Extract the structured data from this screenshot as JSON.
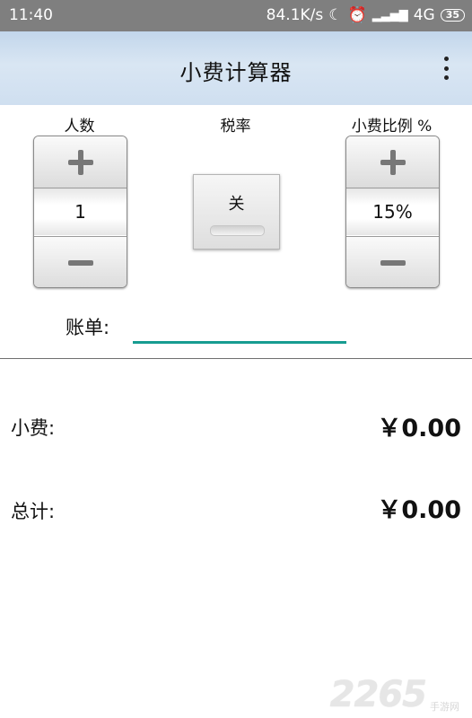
{
  "status_bar": {
    "time": "11:40",
    "speed": "84.1K/s",
    "icons": [
      "moon-icon",
      "alarm-icon",
      "signal-icon"
    ],
    "network": "4G",
    "battery": "35"
  },
  "app_bar": {
    "title": "小费计算器",
    "menu_icon": "overflow-menu-icon"
  },
  "people": {
    "label": "人数",
    "value": "1"
  },
  "tax": {
    "label": "税率",
    "toggle_text": "关"
  },
  "tip_percent": {
    "label": "小费比例 %",
    "value": "15%"
  },
  "bill": {
    "label": "账单:",
    "value": ""
  },
  "results": {
    "tip_label": "小费:",
    "tip_value": "￥0.00",
    "total_label": "总计:",
    "total_value": "￥0.00"
  },
  "watermark": {
    "number": "2265",
    "text": "手游网"
  },
  "colors": {
    "app_bar": "#c9dbee",
    "input_underline": "#179c91",
    "status_bar": "#7f7f7f"
  }
}
